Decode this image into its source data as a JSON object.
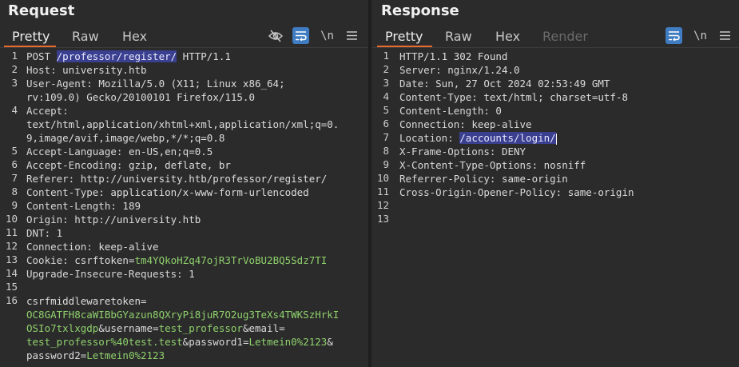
{
  "request": {
    "title": "Request",
    "tabs": [
      "Pretty",
      "Raw",
      "Hex"
    ],
    "tools": {
      "hide_icon": "eye-slash-icon",
      "wrap_icon": "wrap-icon",
      "newline": "\\n",
      "menu_icon": "menu-icon"
    },
    "lines": [
      {
        "n": "1",
        "parts": [
          [
            "POST ",
            "k"
          ],
          [
            "/professor/register/",
            "hl"
          ],
          [
            " HTTP/1.1",
            "v"
          ]
        ]
      },
      {
        "n": "2",
        "parts": [
          [
            "Host: ",
            "k"
          ],
          [
            "university.htb",
            "v"
          ]
        ]
      },
      {
        "n": "3",
        "parts": [
          [
            "User-Agent: ",
            "k"
          ],
          [
            "Mozilla/5.0 (X11; Linux x86_64;",
            "v"
          ]
        ]
      },
      {
        "n": "",
        "parts": [
          [
            "rv:109.0) Gecko/20100101 Firefox/115.0",
            "v"
          ]
        ]
      },
      {
        "n": "4",
        "parts": [
          [
            "Accept: ",
            "k"
          ]
        ]
      },
      {
        "n": "",
        "parts": [
          [
            "text/html,application/xhtml+xml,application/xml;q=0.",
            "v"
          ]
        ]
      },
      {
        "n": "",
        "parts": [
          [
            "9,image/avif,image/webp,*/*;q=0.8",
            "v"
          ]
        ]
      },
      {
        "n": "5",
        "parts": [
          [
            "Accept-Language: ",
            "k"
          ],
          [
            "en-US,en;q=0.5",
            "v"
          ]
        ]
      },
      {
        "n": "6",
        "parts": [
          [
            "Accept-Encoding: ",
            "k"
          ],
          [
            "gzip, deflate, br",
            "v"
          ]
        ]
      },
      {
        "n": "7",
        "parts": [
          [
            "Referer: ",
            "k"
          ],
          [
            "http://university.htb/professor/register/",
            "v"
          ]
        ]
      },
      {
        "n": "8",
        "parts": [
          [
            "Content-Type: ",
            "k"
          ],
          [
            "application/x-www-form-urlencoded",
            "v"
          ]
        ]
      },
      {
        "n": "9",
        "parts": [
          [
            "Content-Length: ",
            "k"
          ],
          [
            "189",
            "v"
          ]
        ]
      },
      {
        "n": "10",
        "parts": [
          [
            "Origin: ",
            "k"
          ],
          [
            "http://university.htb",
            "v"
          ]
        ]
      },
      {
        "n": "11",
        "parts": [
          [
            "DNT: ",
            "k"
          ],
          [
            "1",
            "v"
          ]
        ]
      },
      {
        "n": "12",
        "parts": [
          [
            "Connection: ",
            "k"
          ],
          [
            "keep-alive",
            "v"
          ]
        ]
      },
      {
        "n": "13",
        "parts": [
          [
            "Cookie: ",
            "k"
          ],
          [
            "csrftoken",
            "v"
          ],
          [
            "=",
            "v"
          ],
          [
            "tm4YQkoHZq47ojR3TrVoBU2BQ5Sdz7TI",
            "g"
          ]
        ]
      },
      {
        "n": "14",
        "parts": [
          [
            "Upgrade-Insecure-Requests: ",
            "k"
          ],
          [
            "1",
            "v"
          ]
        ]
      },
      {
        "n": "15",
        "parts": []
      },
      {
        "n": "16",
        "parts": [
          [
            "csrfmiddlewaretoken",
            "v"
          ],
          [
            "=",
            "v"
          ]
        ]
      },
      {
        "n": "",
        "parts": [
          [
            "OC8GATFH8caWIBbGYazun8QXryPi8juR7O2ug3TeXs4TWKSzHrkI",
            "g"
          ]
        ]
      },
      {
        "n": "",
        "parts": [
          [
            "OSIo7txlxgdp",
            "g"
          ],
          [
            "&",
            "v"
          ],
          [
            "username",
            "v"
          ],
          [
            "=",
            "v"
          ],
          [
            "test_professor",
            "g"
          ],
          [
            "&",
            "v"
          ],
          [
            "email",
            "v"
          ],
          [
            "=",
            "v"
          ]
        ]
      },
      {
        "n": "",
        "parts": [
          [
            "test_professor%40test.test",
            "g"
          ],
          [
            "&",
            "v"
          ],
          [
            "password1",
            "v"
          ],
          [
            "=",
            "v"
          ],
          [
            "Letmein0%2123",
            "g"
          ],
          [
            "&",
            "v"
          ]
        ]
      },
      {
        "n": "",
        "parts": [
          [
            "password2",
            "v"
          ],
          [
            "=",
            "v"
          ],
          [
            "Letmein0%2123",
            "g"
          ]
        ]
      }
    ]
  },
  "response": {
    "title": "Response",
    "tabs": [
      "Pretty",
      "Raw",
      "Hex",
      "Render"
    ],
    "tools": {
      "wrap_icon": "wrap-icon",
      "newline": "\\n",
      "menu_icon": "menu-icon"
    },
    "lines": [
      {
        "n": "1",
        "parts": [
          [
            "HTTP/1.1 302 Found",
            "v"
          ]
        ]
      },
      {
        "n": "2",
        "parts": [
          [
            "Server: ",
            "k"
          ],
          [
            "nginx/1.24.0",
            "v"
          ]
        ]
      },
      {
        "n": "3",
        "parts": [
          [
            "Date: ",
            "k"
          ],
          [
            "Sun, 27 Oct 2024 02:53:49 GMT",
            "v"
          ]
        ]
      },
      {
        "n": "4",
        "parts": [
          [
            "Content-Type: ",
            "k"
          ],
          [
            "text/html; charset=utf-8",
            "v"
          ]
        ]
      },
      {
        "n": "5",
        "parts": [
          [
            "Content-Length: ",
            "k"
          ],
          [
            "0",
            "v"
          ]
        ]
      },
      {
        "n": "6",
        "parts": [
          [
            "Connection: ",
            "k"
          ],
          [
            "keep-alive",
            "v"
          ]
        ]
      },
      {
        "n": "7",
        "parts": [
          [
            "Location: ",
            "k"
          ],
          [
            "/accounts/login/",
            "hl"
          ]
        ],
        "cursor": true
      },
      {
        "n": "8",
        "parts": [
          [
            "X-Frame-Options: ",
            "k"
          ],
          [
            "DENY",
            "v"
          ]
        ]
      },
      {
        "n": "9",
        "parts": [
          [
            "X-Content-Type-Options: ",
            "k"
          ],
          [
            "nosniff",
            "v"
          ]
        ]
      },
      {
        "n": "10",
        "parts": [
          [
            "Referrer-Policy: ",
            "k"
          ],
          [
            "same-origin",
            "v"
          ]
        ]
      },
      {
        "n": "11",
        "parts": [
          [
            "Cross-Origin-Opener-Policy: ",
            "k"
          ],
          [
            "same-origin",
            "v"
          ]
        ]
      },
      {
        "n": "12",
        "parts": []
      },
      {
        "n": "13",
        "parts": []
      }
    ]
  },
  "colors": {
    "accent": "#ea6b2d",
    "active_tool": "#3f7cc1",
    "highlight": "#3a3f8f",
    "value_green": "#8fd16c"
  }
}
